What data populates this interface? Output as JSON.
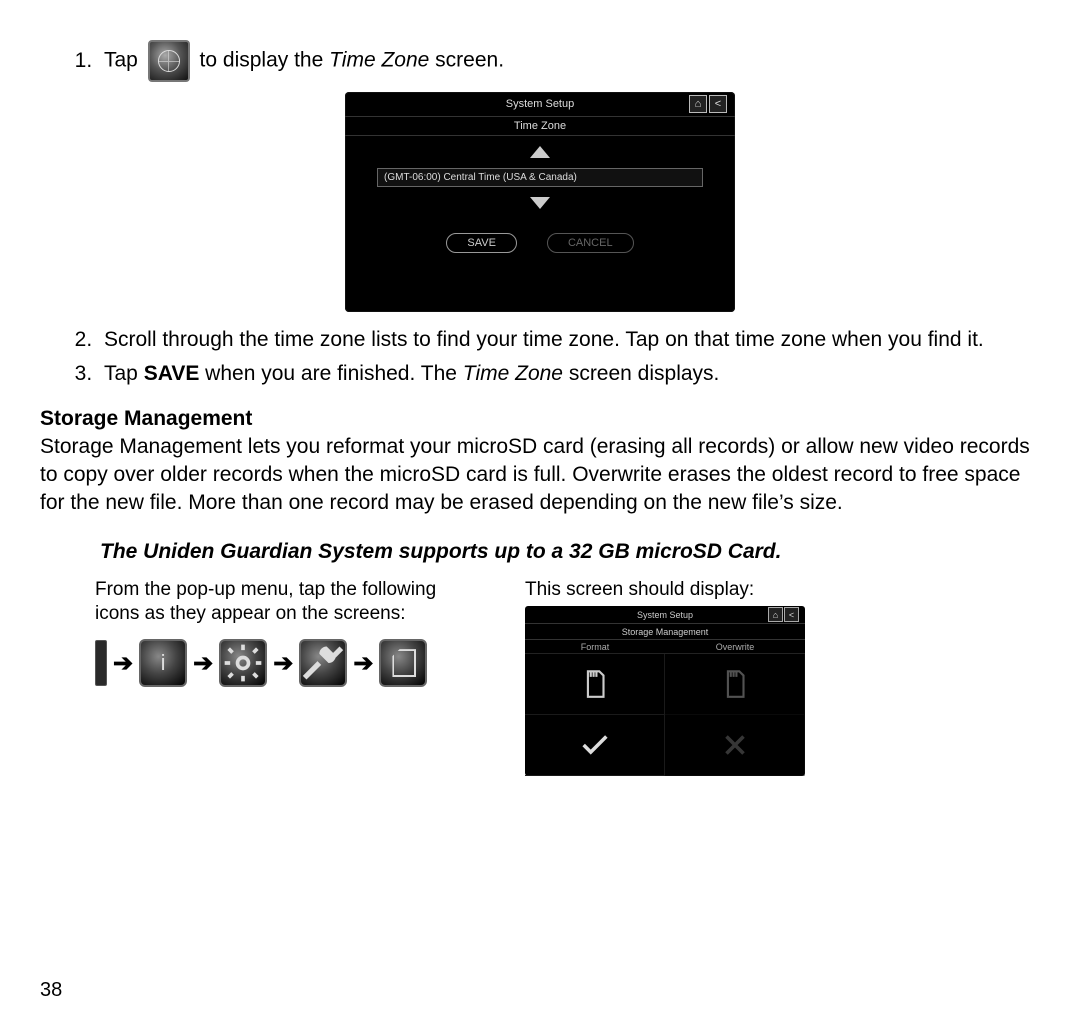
{
  "step1": {
    "num": "1.",
    "before": "Tap",
    "after_a": "to display the ",
    "after_italic": "Time Zone",
    "after_b": " screen."
  },
  "tz_screen": {
    "title": "System Setup",
    "subtitle": "Time Zone",
    "value": "(GMT-06:00) Central Time (USA & Canada)",
    "save": "SAVE",
    "cancel": "CANCEL"
  },
  "step2": "Scroll through the time zone lists to find your time zone.  Tap on that time zone when you find it.",
  "step3": {
    "a": "Tap ",
    "bold": "SAVE",
    "b": " when you are finished. The ",
    "italic": "Time Zone",
    "c": " screen displays."
  },
  "heading": "Storage Management",
  "paragraph": "Storage Management lets you reformat your microSD card (erasing all records) or allow new video records to copy over older records when the microSD card is full. Overwrite erases the oldest record to free space for the new file. More than one record may be erased depending on the new file’s size.",
  "note": "The Uniden Guardian System supports up to a 32 GB microSD Card.",
  "left_col": "From the pop-up menu, tap the following icons as they appear on the screens:",
  "right_col": "This screen should display:",
  "arrow": "➔",
  "storage_screen": {
    "title": "System Setup",
    "subtitle": "Storage Management",
    "col1": "Format",
    "col2": "Overwrite"
  },
  "page": "38"
}
